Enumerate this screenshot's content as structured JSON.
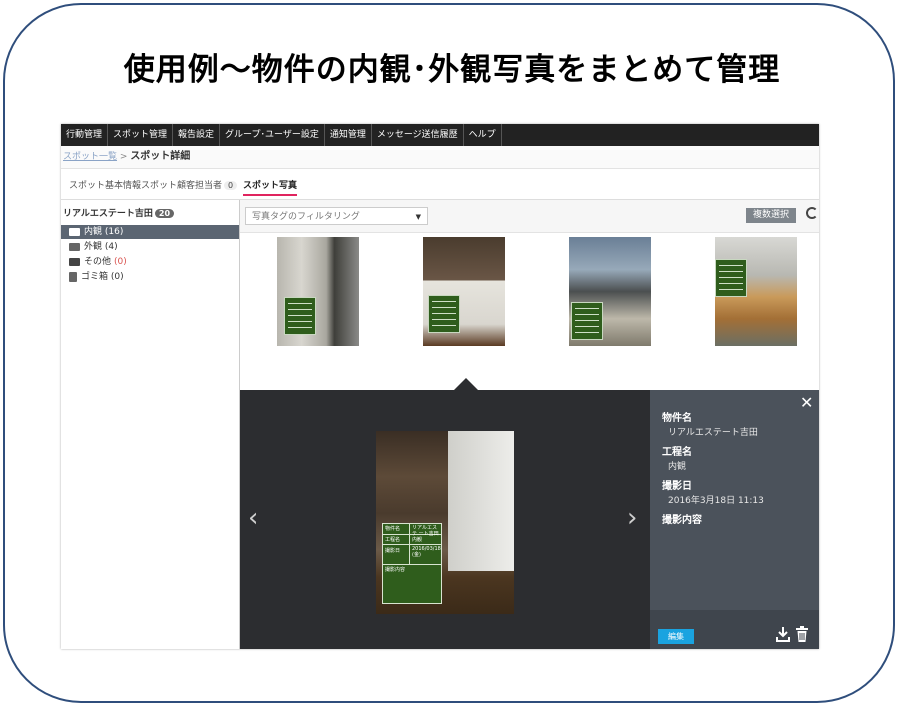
{
  "headline": "使用例～物件の内観･外観写真をまとめて管理",
  "topnav": [
    "行動管理",
    "スポット管理",
    "報告設定",
    "グループ･ユーザー設定",
    "通知管理",
    "メッセージ送信履歴",
    "ヘルプ"
  ],
  "breadcrumb": {
    "link": "スポット一覧",
    "separator": ">",
    "current": "スポット詳細"
  },
  "tabs": [
    {
      "label": "スポット基本情報"
    },
    {
      "label": "スポット顧客担当者",
      "count": "0"
    },
    {
      "label": "スポット写真"
    }
  ],
  "sidebar": {
    "owner": "リアルエステート吉田",
    "owner_count": "20",
    "folders": [
      {
        "label": "内観",
        "count": "(16)",
        "icon": "folder-open-icon"
      },
      {
        "label": "外観",
        "count": "(4)",
        "icon": "folder-open-icon"
      },
      {
        "label": "その他",
        "count": "(0)",
        "icon": "folder-icon"
      },
      {
        "label": "ゴミ箱",
        "count": "(0)",
        "icon": "trash-icon"
      }
    ]
  },
  "toolbar": {
    "filter_placeholder": "写真タグのフィルタリング",
    "multi_select": "複数選択"
  },
  "detail": {
    "board": {
      "property_label": "物件名",
      "property_value": "リアルエステ ート吉田",
      "process_label": "工程名",
      "process_value": "内観",
      "date_label": "撮影日",
      "date_value": "2016/03/18 (金)",
      "content_label": "撮影内容"
    },
    "fields": [
      {
        "label": "物件名",
        "value": "リアルエステート吉田"
      },
      {
        "label": "工程名",
        "value": "内観"
      },
      {
        "label": "撮影日",
        "value": "2016年3月18日 11:13"
      },
      {
        "label": "撮影内容",
        "value": ""
      }
    ],
    "edit_button": "編集"
  },
  "colors": {
    "nav_bg": "#222222",
    "accent": "#e0245e",
    "edit_button": "#1aa3e0",
    "dark_pane": "#2c2d30",
    "info_pane": "#4b525b"
  }
}
